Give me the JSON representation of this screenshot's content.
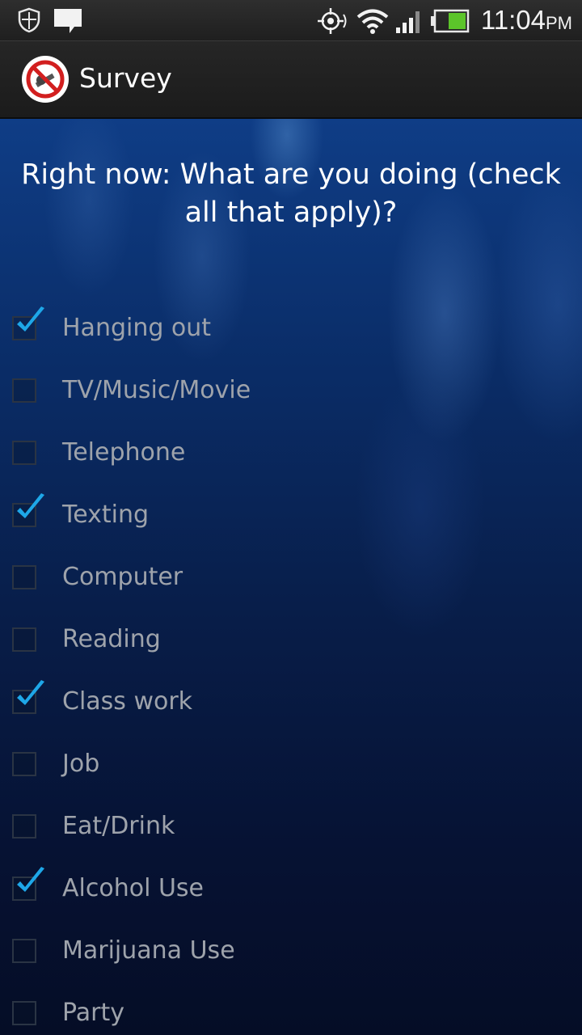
{
  "status_bar": {
    "time": "11:04",
    "ampm": "PM",
    "icons": [
      "shield-icon",
      "message-icon",
      "gps-icon",
      "wifi-icon",
      "signal-icon",
      "battery-icon"
    ]
  },
  "action_bar": {
    "title": "Survey",
    "icon": "no-smoking-app-icon"
  },
  "survey": {
    "question": "Right now: What are you doing (check all that apply)?",
    "options": [
      {
        "label": "Hanging out",
        "checked": true
      },
      {
        "label": "TV/Music/Movie",
        "checked": false
      },
      {
        "label": "Telephone",
        "checked": false
      },
      {
        "label": "Texting",
        "checked": true
      },
      {
        "label": "Computer",
        "checked": false
      },
      {
        "label": "Reading",
        "checked": false
      },
      {
        "label": "Class work",
        "checked": true
      },
      {
        "label": "Job",
        "checked": false
      },
      {
        "label": "Eat/Drink",
        "checked": false
      },
      {
        "label": "Alcohol Use",
        "checked": true
      },
      {
        "label": "Marijuana Use",
        "checked": false
      },
      {
        "label": "Party",
        "checked": false
      }
    ]
  },
  "colors": {
    "accent": "#1ea7e8",
    "label": "#9ea3ab",
    "background_top": "#0f3d86",
    "background_bottom": "#050d26"
  }
}
